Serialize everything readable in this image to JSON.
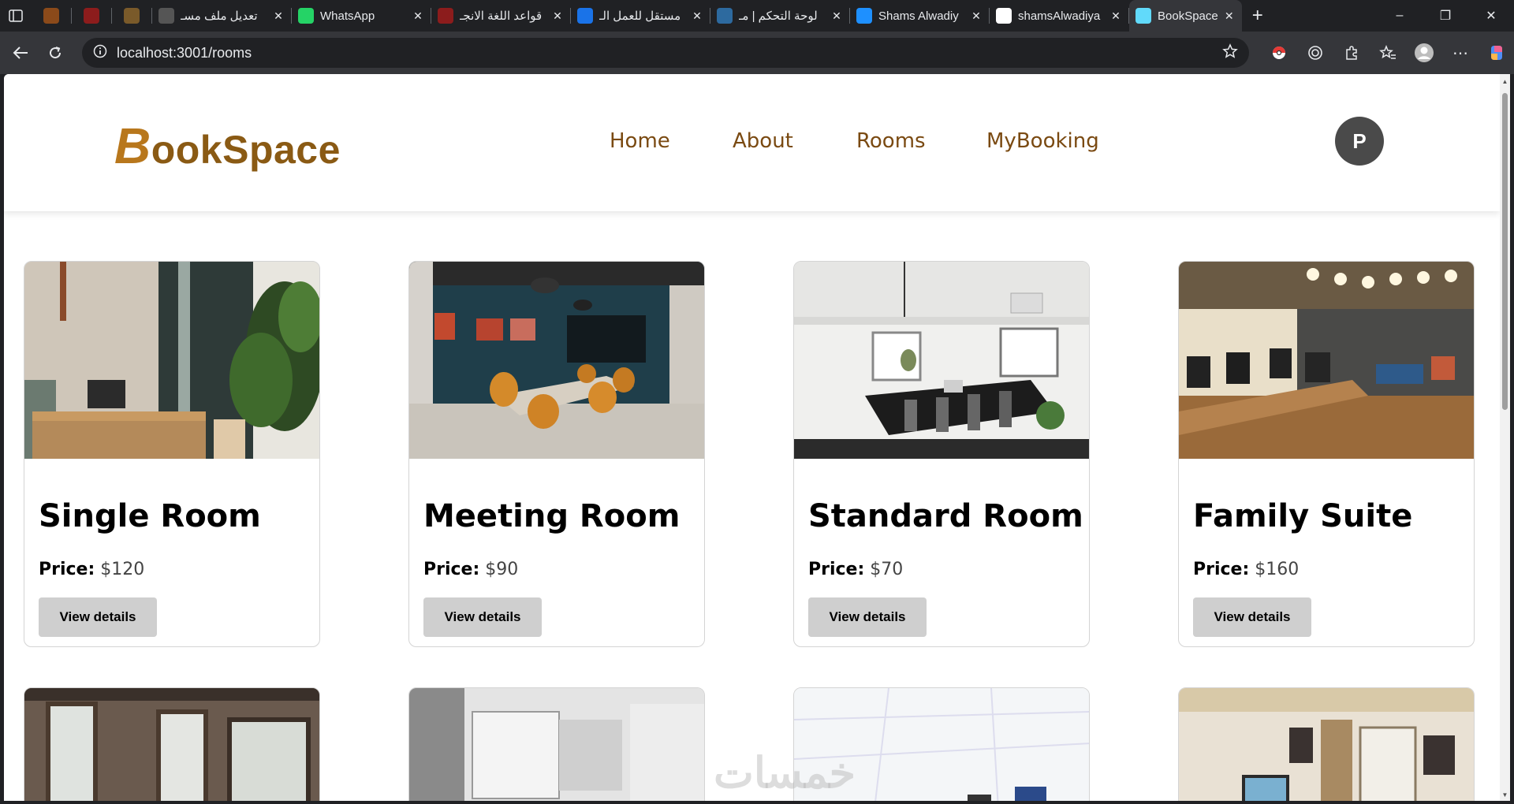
{
  "browser": {
    "tabs": [
      {
        "title": "",
        "favicon": "bowl-icon",
        "color": "#8b4a1a",
        "kind": "small"
      },
      {
        "title": "",
        "favicon": "youtube-icon",
        "color": "#8c1c1c",
        "kind": "small"
      },
      {
        "title": "",
        "favicon": "number-5-icon",
        "color": "#7a5a2a",
        "kind": "small"
      },
      {
        "title": "تعديل ملف مسـ",
        "favicon": "openai-icon",
        "color": "#555555",
        "kind": "normal"
      },
      {
        "title": "WhatsApp",
        "favicon": "whatsapp-icon",
        "color": "#25d366",
        "kind": "normal"
      },
      {
        "title": "قواعد اللغة الانجـ",
        "favicon": "youtube-icon",
        "color": "#8c1c1c",
        "kind": "normal"
      },
      {
        "title": "مستقل للعمل الـ",
        "favicon": "search-icon",
        "color": "#1a73e8",
        "kind": "normal"
      },
      {
        "title": "لوحة التحكم | مـ",
        "favicon": "circle-icon",
        "color": "#2d6a9f",
        "kind": "normal"
      },
      {
        "title": "Shams Alwadiy",
        "favicon": "circle-icon",
        "color": "#1e90ff",
        "kind": "normal"
      },
      {
        "title": "shamsAlwadiya",
        "favicon": "github-icon",
        "color": "#ffffff",
        "kind": "normal"
      },
      {
        "title": "BookSpace",
        "favicon": "react-icon",
        "color": "#61dafb",
        "kind": "active"
      }
    ],
    "url": "localhost:3001/rooms"
  },
  "site": {
    "logo_initial": "B",
    "logo_rest": "ookSpace",
    "nav": {
      "home": "Home",
      "about": "About",
      "rooms": "Rooms",
      "mybooking": "MyBooking"
    },
    "avatar_letter": "P"
  },
  "rooms": [
    {
      "name": "Single Room",
      "price_label": "Price:",
      "price": "$120",
      "button": "View details"
    },
    {
      "name": "Meeting Room",
      "price_label": "Price:",
      "price": "$90",
      "button": "View details"
    },
    {
      "name": "Standard Room",
      "price_label": "Price:",
      "price": "$70",
      "button": "View details"
    },
    {
      "name": "Family Suite",
      "price_label": "Price:",
      "price": "$160",
      "button": "View details"
    }
  ],
  "watermark": "خمسات"
}
